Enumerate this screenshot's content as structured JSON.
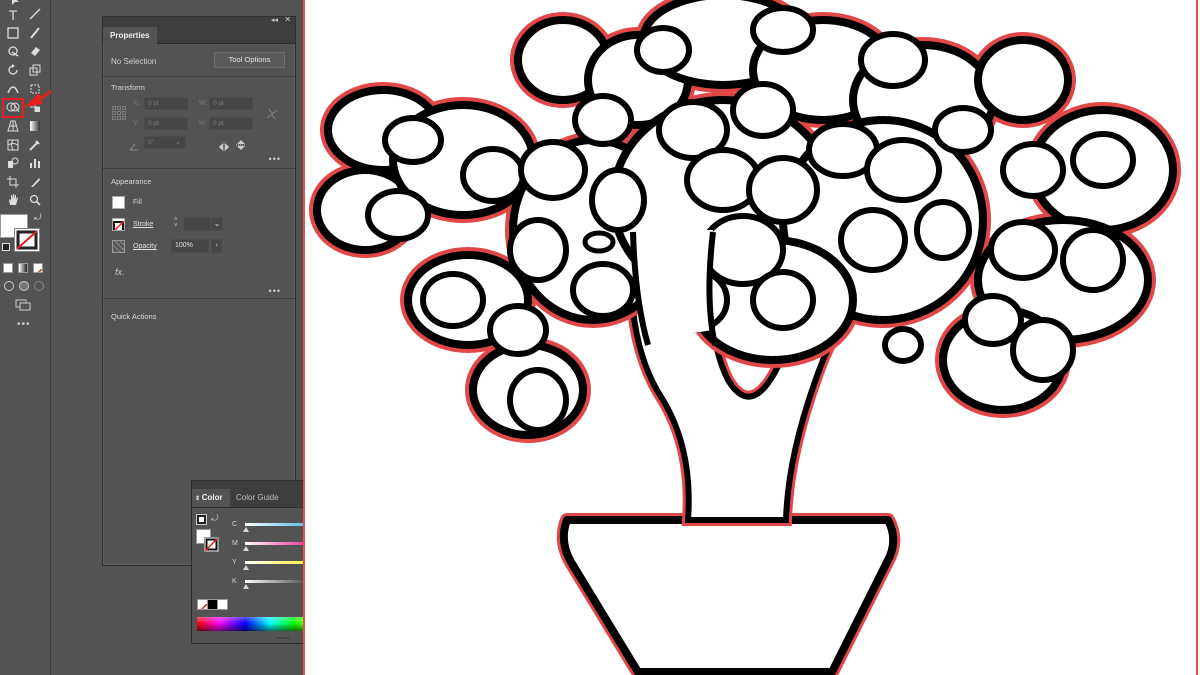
{
  "properties_panel": {
    "tab_label": "Properties",
    "selection_status": "No Selection",
    "tool_options_label": "Tool Options",
    "transform": {
      "heading": "Transform",
      "x_label": "X:",
      "x_value": "0 pt",
      "y_label": "Y:",
      "y_value": "0 pt",
      "w_label": "W:",
      "w_value": "0 pt",
      "h_label": "H:",
      "h_value": "0 pt",
      "angle_value": "0°"
    },
    "appearance": {
      "heading": "Appearance",
      "fill_label": "Fill",
      "stroke_label": "Stroke",
      "opacity_label": "Opacity",
      "opacity_value": "100%",
      "fx_label": "fx."
    },
    "quick_actions_heading": "Quick Actions"
  },
  "color_panel": {
    "tab_color": "Color",
    "tab_color_guide": "Color Guide",
    "sliders": [
      {
        "label": "C",
        "value": "0",
        "unit": "%",
        "color": "#27a9e1"
      },
      {
        "label": "M",
        "value": "0",
        "unit": "%",
        "color": "#e6007e"
      },
      {
        "label": "Y",
        "value": "0",
        "unit": "%",
        "color": "#fff200"
      },
      {
        "label": "K",
        "value": "0",
        "unit": "%",
        "color": "#231f20"
      }
    ]
  },
  "toolbar": {
    "icons": [
      "selection-tool-icon",
      "type-tool-icon",
      "line-tool-icon",
      "rectangle-tool-icon",
      "paintbrush-tool-icon",
      "shaper-tool-icon",
      "eraser-tool-icon",
      "rotate-tool-icon",
      "scale-tool-icon",
      "puppet-warp-tool-icon",
      "free-transform-tool-icon",
      "shape-builder-tool-icon",
      "live-paint-tool-icon",
      "perspective-grid-tool-icon",
      "gradient-tool-icon",
      "mesh-tool-icon",
      "eyedropper-tool-icon",
      "blend-tool-icon",
      "symbol-sprayer-tool-icon",
      "column-graph-tool-icon",
      "artboard-tool-icon",
      "slice-tool-icon",
      "hand-tool-icon",
      "zoom-tool-icon"
    ]
  },
  "colors": {
    "ui_bg": "#535353",
    "panel_header": "#3e3e3e",
    "highlight_red": "#e62020",
    "artwork_outline": "#e04848"
  }
}
